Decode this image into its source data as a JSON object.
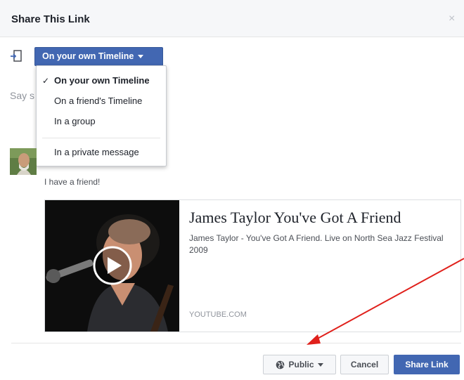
{
  "dialog": {
    "title": "Share This Link",
    "close_glyph": "×"
  },
  "destination": {
    "selected_label": "On your own Timeline",
    "icon": "share-arrow-icon"
  },
  "composer": {
    "placeholder_fragment": "Say s"
  },
  "dropdown": {
    "check_glyph": "✓",
    "items": [
      {
        "label": "On your own Timeline",
        "selected": true
      },
      {
        "label": "On a friend's Timeline",
        "selected": false
      },
      {
        "label": "In a group",
        "selected": false
      },
      {
        "label": "In a private message",
        "selected": false
      }
    ]
  },
  "post": {
    "text": "I have a friend!"
  },
  "link_preview": {
    "title": "James Taylor You've Got A Friend",
    "description": "James Taylor - You've Got A Friend. Live on North Sea Jazz Festival 2009",
    "source": "YOUTUBE.COM"
  },
  "footer": {
    "privacy_label": "Public",
    "cancel_label": "Cancel",
    "share_label": "Share Link"
  },
  "colors": {
    "primary_button": "#4267b2",
    "annotation_arrow": "#e0201b"
  }
}
